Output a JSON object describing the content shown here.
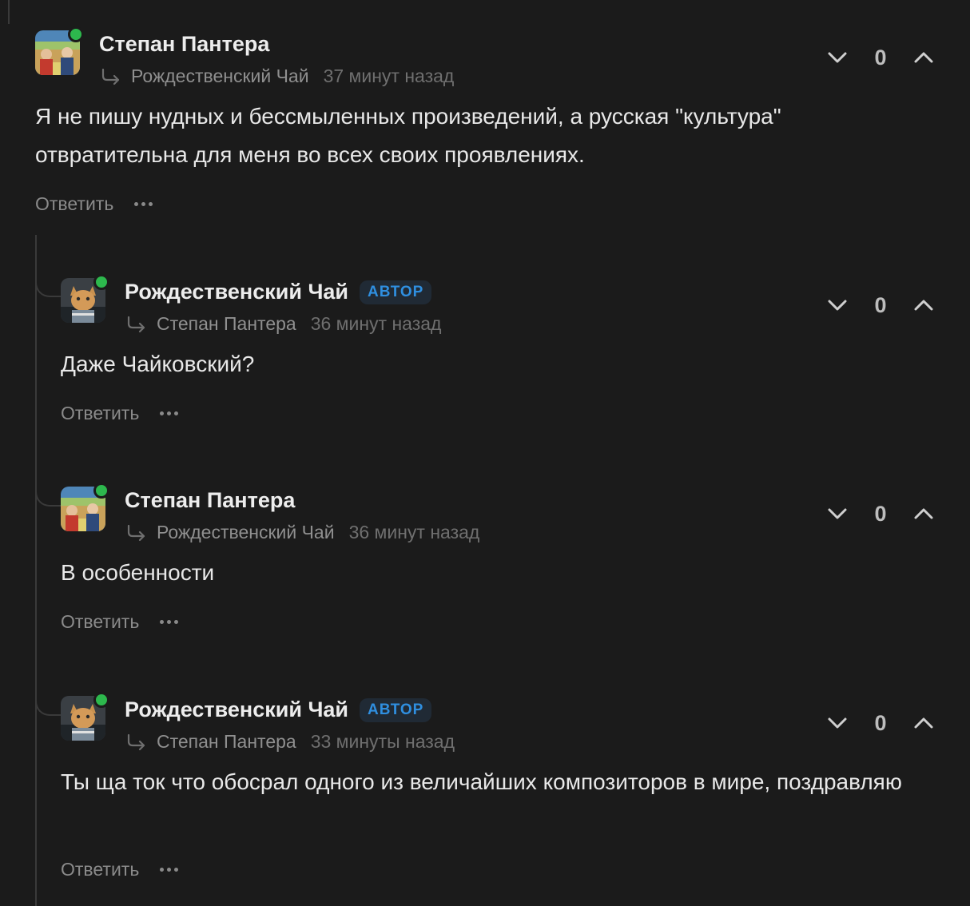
{
  "labels": {
    "reply": "Ответить",
    "author_badge": "АВТОР"
  },
  "colors": {
    "background": "#1b1b1b",
    "online": "#2db84d",
    "badge_text": "#2f8fe0"
  },
  "comments": [
    {
      "author": "Степан Пантера",
      "is_author": false,
      "reply_to": "Рождественский Чай",
      "time": "37 минут назад",
      "score": "0",
      "text": "Я не пишу нудных и бессмыленных произведений, а русская \"культура\" отвратительна для меня во всех своих проявлениях.",
      "avatar_icon": "painting-avatar-icon"
    },
    {
      "author": "Рождественский Чай",
      "is_author": true,
      "reply_to": "Степан Пантера",
      "time": "36 минут назад",
      "score": "0",
      "text": "Даже Чайковский?",
      "avatar_icon": "cat-avatar-icon"
    },
    {
      "author": "Степан Пантера",
      "is_author": false,
      "reply_to": "Рождественский Чай",
      "time": "36 минут назад",
      "score": "0",
      "text": "В особенности",
      "avatar_icon": "painting-avatar-icon"
    },
    {
      "author": "Рождественский Чай",
      "is_author": true,
      "reply_to": "Степан Пантера",
      "time": "33 минуты назад",
      "score": "0",
      "text": "Ты ща ток что обосрал одного из величайших композиторов в мире, поздравляю",
      "avatar_icon": "cat-avatar-icon"
    }
  ]
}
